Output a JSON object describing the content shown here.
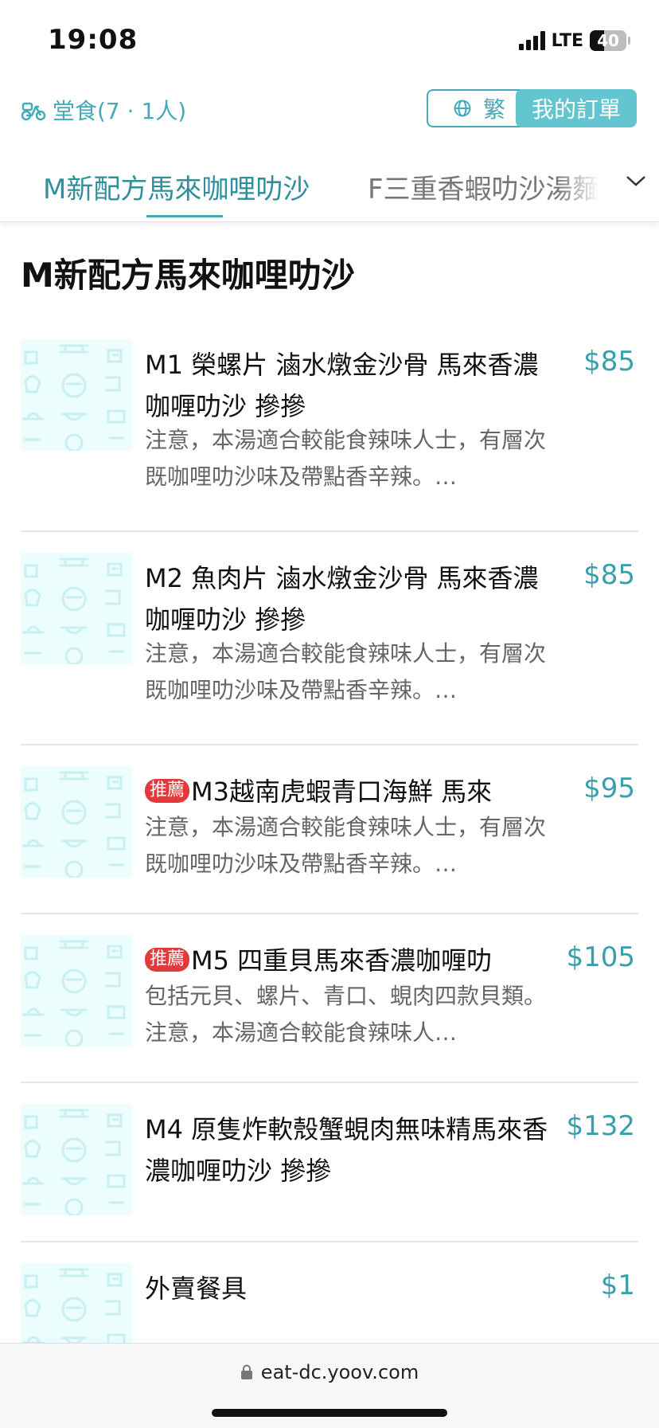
{
  "status_bar": {
    "time": "19:08",
    "network": "LTE",
    "battery": "40",
    "battery_level": 0.4
  },
  "header": {
    "dine_in": "堂食(7 · 1人)",
    "language": "繁",
    "my_orders": "我的訂單"
  },
  "tabs": [
    {
      "label": "M新配方馬來咖哩叻沙",
      "active": true
    },
    {
      "label": "F三重香蝦叻沙湯麵",
      "active": false
    }
  ],
  "section": {
    "title": "M新配方馬來咖哩叻沙"
  },
  "items": [
    {
      "tag": "",
      "name": "M1 榮螺片 滷水燉金沙骨 馬來香濃咖喱叻沙 摻摻",
      "desc": "注意，本湯適合較能食辣味人士，有層次既咖哩叻沙味及帶點香辛辣。…",
      "price": "$85"
    },
    {
      "tag": "",
      "name": "M2 魚肉片 滷水燉金沙骨 馬來香濃咖喱叻沙 摻摻",
      "desc": "注意，本湯適合較能食辣味人士，有層次既咖哩叻沙味及帶點香辛辣。…",
      "price": "$85"
    },
    {
      "tag": "推薦",
      "name": "M3越南虎蝦青口海鮮 馬來",
      "desc": "注意，本湯適合較能食辣味人士，有層次既咖哩叻沙味及帶點香辛辣。…",
      "price": "$95"
    },
    {
      "tag": "推薦",
      "name": "M5 四重貝馬來香濃咖喱叻",
      "desc": "包括元貝、螺片、青口、蜆肉四款貝類。注意，本湯適合較能食辣味人…",
      "price": "$105"
    },
    {
      "tag": "",
      "name": "M4 原隻炸軟殼蟹蜆肉無味精馬來香濃咖喱叻沙 摻摻",
      "desc": "",
      "price": "$132"
    },
    {
      "tag": "",
      "name": "外賣餐具",
      "desc": "",
      "price": "$1"
    }
  ],
  "url_bar": {
    "url": "eat-dc.yoov.com"
  },
  "colors": {
    "accent": "#45aab8",
    "accent_button": "#63c5cf",
    "tag": "#e23a3a",
    "thumb_bg": "#ebfdfd"
  }
}
